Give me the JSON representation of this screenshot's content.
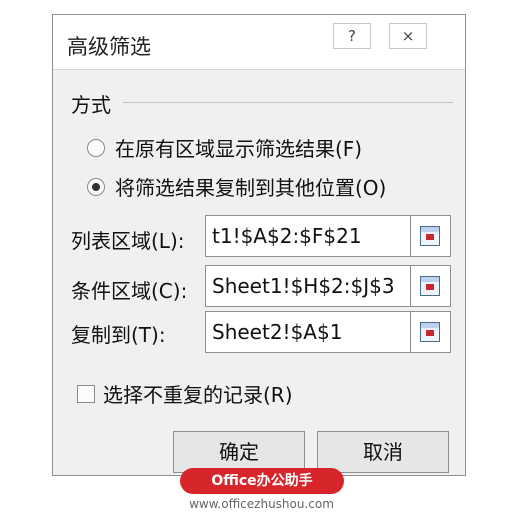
{
  "dialog": {
    "title": "高级筛选",
    "help_glyph": "?",
    "close_glyph": "×",
    "section_label": "方式",
    "options": [
      {
        "label": "在原有区域显示筛选结果(F)",
        "selected": false
      },
      {
        "label": "将筛选结果复制到其他位置(O)",
        "selected": true
      }
    ],
    "fields": [
      {
        "label": "列表区域(L):",
        "value": "t1!$A$2:$F$21"
      },
      {
        "label": "条件区域(C):",
        "value": "Sheet1!$H$2:$J$3"
      },
      {
        "label": "复制到(T):",
        "value": "Sheet2!$A$1"
      }
    ],
    "unique_label": "选择不重复的记录(R)",
    "unique_checked": false,
    "ok_label": "确定",
    "cancel_label": "取消"
  },
  "watermark": {
    "brand": "Office办公助手",
    "url": "www.officezhushou.com"
  },
  "colors": {
    "watermark_bg": "#d7262b"
  }
}
